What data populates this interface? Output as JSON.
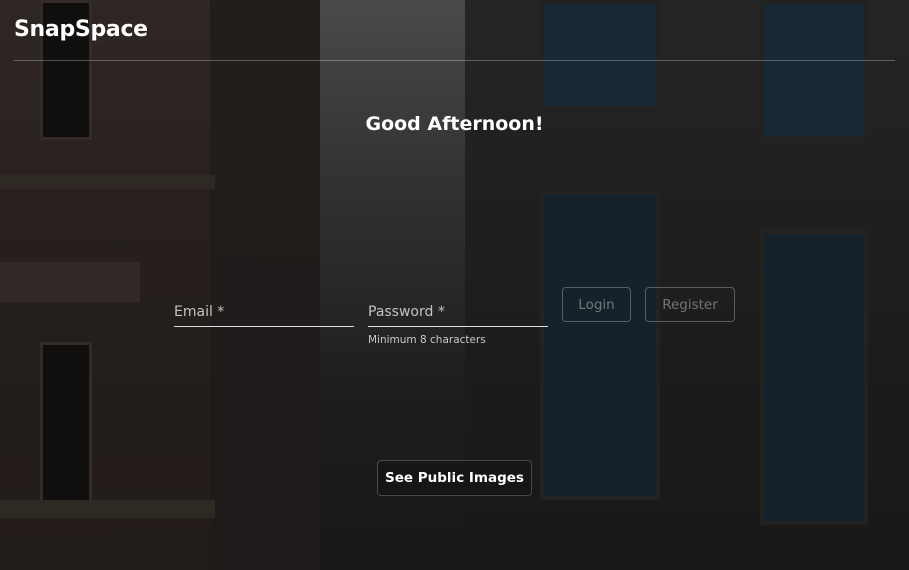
{
  "app": {
    "title": "SnapSpace"
  },
  "main": {
    "greeting": "Good Afternoon!"
  },
  "login_form": {
    "email_label": "Email *",
    "password_label": "Password *",
    "password_helper": "Minimum 8 characters",
    "login_label": "Login",
    "register_label": "Register"
  },
  "public": {
    "see_public_label": "See Public Images"
  },
  "colors": {
    "text": "#ffffff",
    "background": "#1c1a19"
  }
}
